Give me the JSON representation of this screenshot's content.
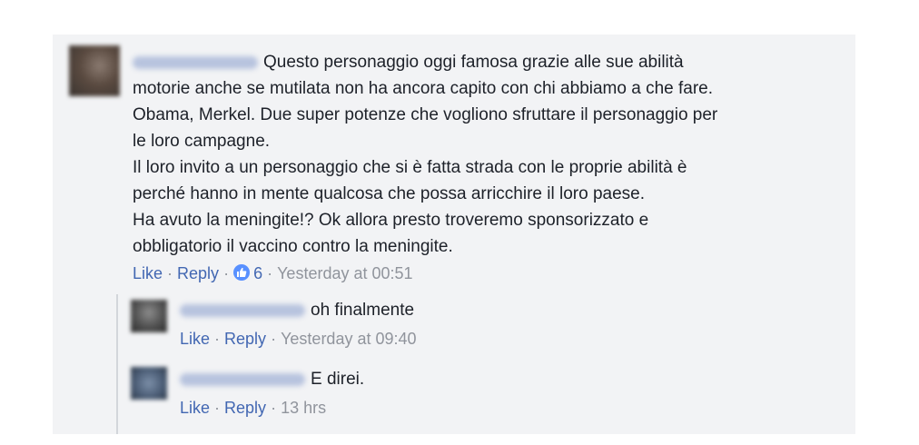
{
  "comment": {
    "lines": [
      "Questo personaggio oggi famosa grazie alle sue abilità",
      "motorie anche se mutilata non ha ancora capito con chi abbiamo a che fare.",
      "Obama, Merkel. Due super potenze che vogliono sfruttare il personaggio per",
      "le loro campagne.",
      "Il loro invito a un personaggio che si è fatta strada con le proprie abilità è",
      "perché hanno in mente qualcosa che possa arricchire il loro paese.",
      "Ha avuto la meningite!? Ok allora presto troveremo sponsorizzato e",
      "obbligatorio il vaccino contro la meningite."
    ],
    "like_label": "Like",
    "reply_label": "Reply",
    "reaction_count": "6",
    "reaction_icon": "thumbs-up-icon",
    "timestamp": "Yesterday at 00:51"
  },
  "replies": [
    {
      "text": "oh finalmente",
      "like_label": "Like",
      "reply_label": "Reply",
      "timestamp": "Yesterday at 09:40"
    },
    {
      "text": "E direi.",
      "like_label": "Like",
      "reply_label": "Reply",
      "timestamp": "13 hrs"
    }
  ],
  "colors": {
    "panel_bg": "#f2f3f5",
    "link": "#4267b2",
    "meta": "#90949c",
    "text": "#1d2129",
    "reaction": "#5890ff"
  }
}
